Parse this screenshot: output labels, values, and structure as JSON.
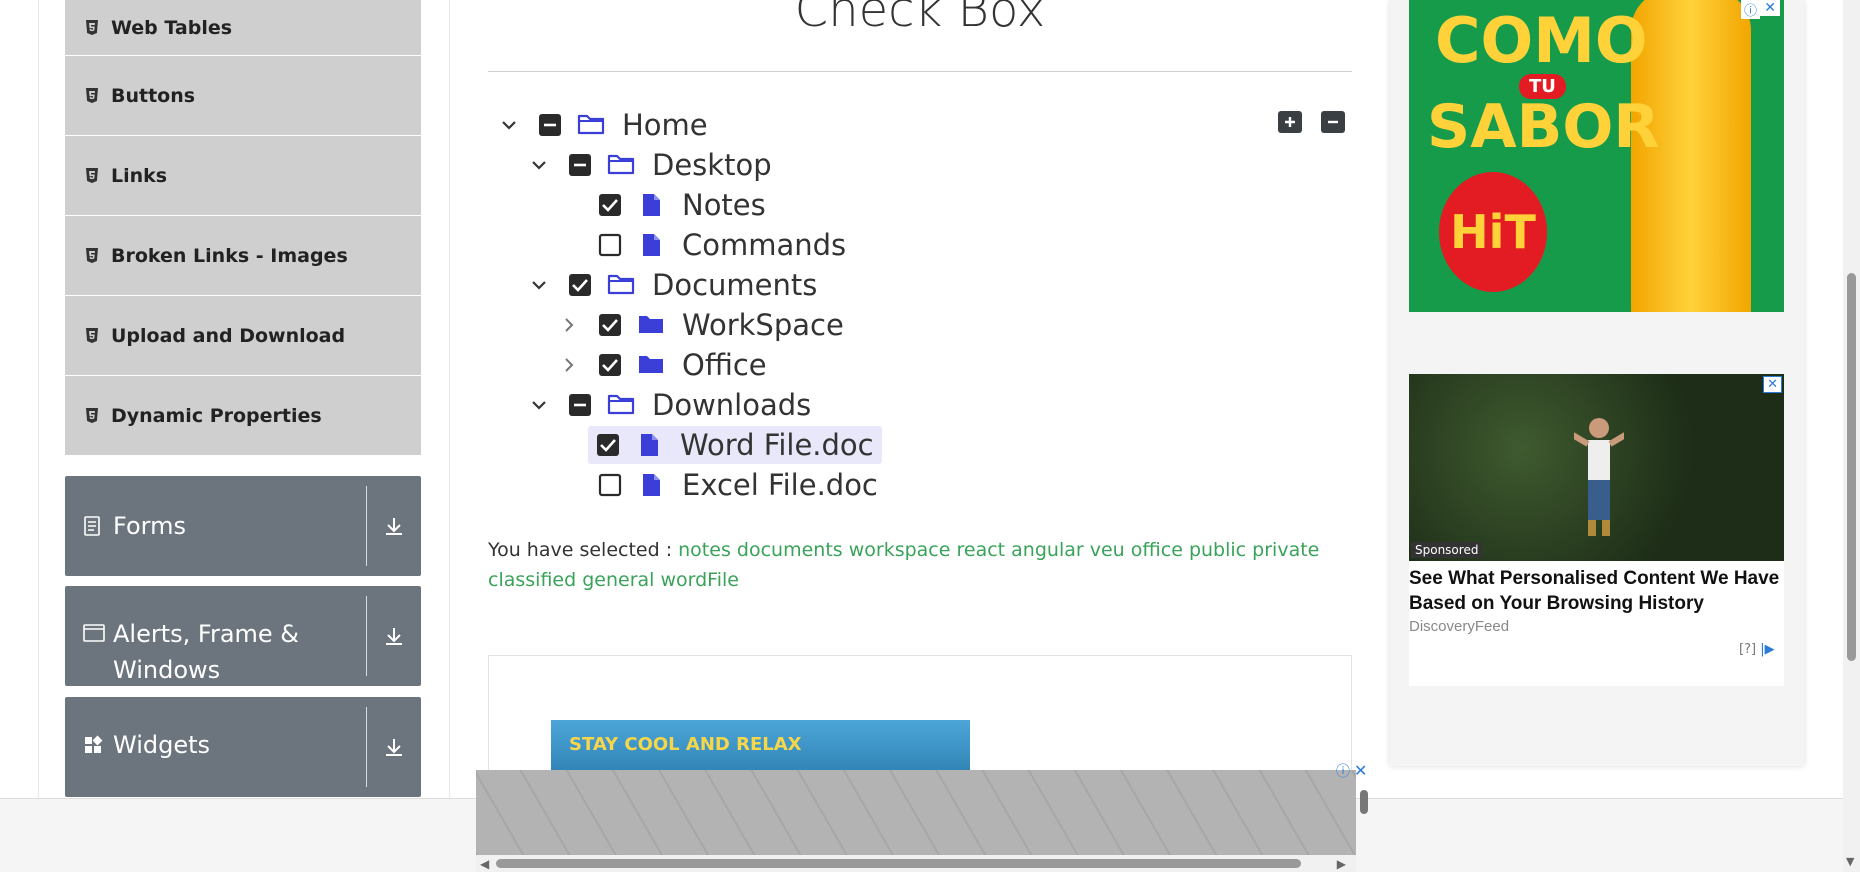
{
  "sidebar": {
    "items": [
      {
        "label": "Web Tables"
      },
      {
        "label": "Buttons"
      },
      {
        "label": "Links"
      },
      {
        "label": "Broken Links - Images"
      },
      {
        "label": "Upload and Download"
      },
      {
        "label": "Dynamic Properties"
      }
    ],
    "groups": [
      {
        "label": "Forms"
      },
      {
        "label": "Alerts, Frame & Windows"
      },
      {
        "label": "Widgets"
      }
    ]
  },
  "main": {
    "title": "Check Box",
    "tree": [
      {
        "label": "Home",
        "state": "partial",
        "type": "folder-open",
        "caret": "down"
      },
      {
        "label": "Desktop",
        "state": "partial",
        "type": "folder-open",
        "caret": "down"
      },
      {
        "label": "Notes",
        "state": "checked",
        "type": "file"
      },
      {
        "label": "Commands",
        "state": "unchecked",
        "type": "file"
      },
      {
        "label": "Documents",
        "state": "checked",
        "type": "folder-open",
        "caret": "down"
      },
      {
        "label": "WorkSpace",
        "state": "checked",
        "type": "folder-closed",
        "caret": "right"
      },
      {
        "label": "Office",
        "state": "checked",
        "type": "folder-closed",
        "caret": "right"
      },
      {
        "label": "Downloads",
        "state": "partial",
        "type": "folder-open",
        "caret": "down"
      },
      {
        "label": "Word File.doc",
        "state": "checked",
        "type": "file",
        "highlighted": true
      },
      {
        "label": "Excel File.doc",
        "state": "unchecked",
        "type": "file"
      }
    ],
    "result_prefix": "You have selected :",
    "selected": [
      "notes",
      "documents",
      "workspace",
      "react",
      "angular",
      "veu",
      "office",
      "public",
      "private",
      "classified",
      "general",
      "wordFile"
    ],
    "bottom_ad_text": "STAY COOL AND RELAX"
  },
  "ads": {
    "ad1": {
      "line1": "COMO",
      "line2": "TU",
      "line3": "SABOR",
      "brand": "HiT"
    },
    "ad2": {
      "sponsored": "Sponsored",
      "headline": "See What Personalised Content We Have Based on Your Browsing History",
      "source": "DiscoveryFeed",
      "help": "[?]"
    }
  },
  "colors": {
    "accent_green": "#3aa35a",
    "icon_blue": "#3b3fd8",
    "sidebar_gray": "#cfcfcf",
    "group_gray": "#6c757d"
  }
}
